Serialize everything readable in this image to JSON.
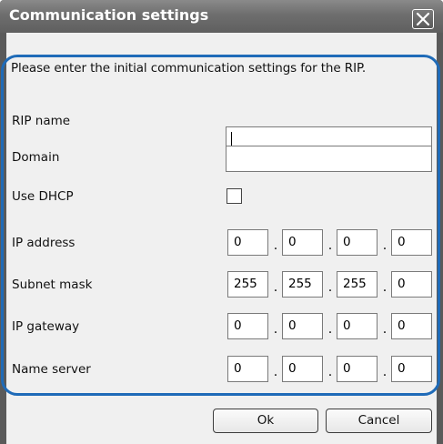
{
  "window": {
    "title": "Communication settings"
  },
  "intro_text": "Please enter the initial communication settings for the RIP.",
  "fields": {
    "rip_name": {
      "label": "RIP name",
      "value": ""
    },
    "domain": {
      "label": "Domain",
      "value": ""
    },
    "use_dhcp": {
      "label": "Use DHCP",
      "checked": false
    },
    "ip_address": {
      "label": "IP address",
      "octets": [
        "0",
        "0",
        "0",
        "0"
      ]
    },
    "subnet_mask": {
      "label": "Subnet mask",
      "octets": [
        "255",
        "255",
        "255",
        "0"
      ]
    },
    "ip_gateway": {
      "label": "IP gateway",
      "octets": [
        "0",
        "0",
        "0",
        "0"
      ]
    },
    "name_server": {
      "label": "Name server",
      "octets": [
        "0",
        "0",
        "0",
        "0"
      ]
    }
  },
  "octet_separator": ".",
  "buttons": {
    "ok": "Ok",
    "cancel": "Cancel"
  },
  "colors": {
    "title_bar": "#6e6e6e",
    "dialog_background": "#f0f0f0",
    "highlight_border": "#1f6bb8"
  },
  "icons": {
    "close": "close-icon"
  }
}
